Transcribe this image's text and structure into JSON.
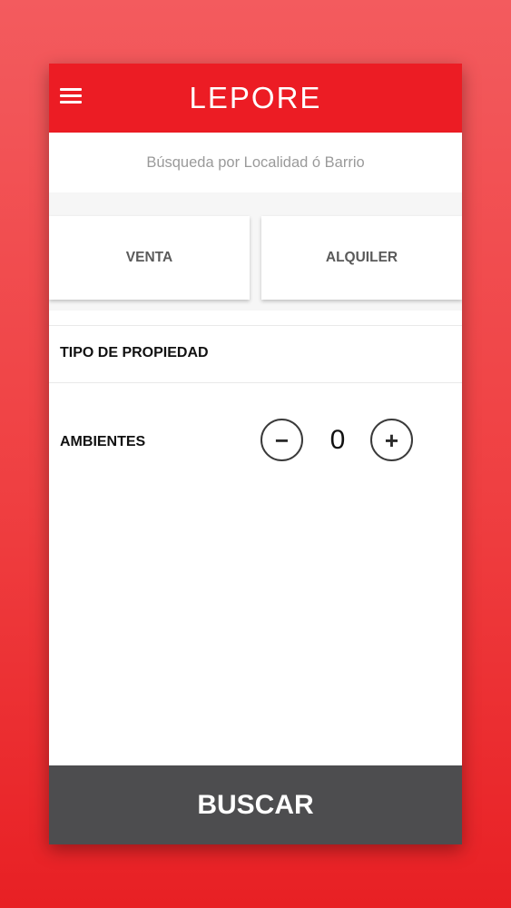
{
  "header": {
    "logo": "LEPORE"
  },
  "search": {
    "placeholder": "Búsqueda por Localidad ó Barrio"
  },
  "operation": {
    "venta_label": "VENTA",
    "alquiler_label": "ALQUILER"
  },
  "tipo_propiedad": {
    "label": "TIPO DE PROPIEDAD"
  },
  "ambientes": {
    "label": "AMBIENTES",
    "value": "0",
    "minus_symbol": "−",
    "plus_symbol": "+"
  },
  "footer": {
    "buscar_label": "BUSCAR"
  },
  "colors": {
    "brand_red": "#ec1c24",
    "button_gray": "#4d4d4f"
  },
  "icons": {
    "menu": "hamburger-menu-icon",
    "minus": "minus-circle-icon",
    "plus": "plus-circle-icon"
  }
}
